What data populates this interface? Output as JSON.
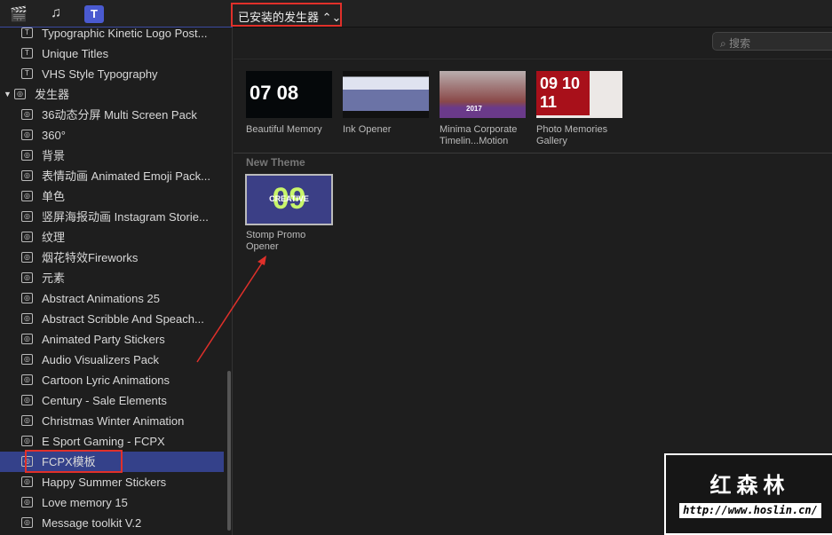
{
  "toolbar": {
    "icons": [
      "clapper-star-icon",
      "music-photo-icon",
      "titles-generators-icon"
    ],
    "selector_label": "已安装的发生器 ⌃⌄"
  },
  "sidebar": {
    "items": [
      {
        "label": "Typographic Kinetic Logo Post...",
        "icon": "title-icon"
      },
      {
        "label": "Unique Titles",
        "icon": "title-icon"
      },
      {
        "label": "VHS Style Typography",
        "icon": "title-icon"
      },
      {
        "label": "发生器",
        "icon": "generator-icon",
        "group": true
      },
      {
        "label": "36动态分屏 Multi Screen Pack",
        "icon": "generator-icon"
      },
      {
        "label": "360°",
        "icon": "generator-icon"
      },
      {
        "label": "背景",
        "icon": "generator-icon"
      },
      {
        "label": "表情动画 Animated Emoji Pack...",
        "icon": "generator-icon"
      },
      {
        "label": "单色",
        "icon": "generator-icon"
      },
      {
        "label": "竖屏海报动画 Instagram Storie...",
        "icon": "generator-icon"
      },
      {
        "label": "纹理",
        "icon": "generator-icon"
      },
      {
        "label": "烟花特效Fireworks",
        "icon": "generator-icon"
      },
      {
        "label": "元素",
        "icon": "generator-icon"
      },
      {
        "label": "Abstract Animations 25",
        "icon": "generator-icon"
      },
      {
        "label": "Abstract Scribble And Speach...",
        "icon": "generator-icon"
      },
      {
        "label": "Animated Party Stickers",
        "icon": "generator-icon"
      },
      {
        "label": "Audio Visualizers Pack",
        "icon": "generator-icon"
      },
      {
        "label": "Cartoon Lyric Animations",
        "icon": "generator-icon"
      },
      {
        "label": "Century - Sale Elements",
        "icon": "generator-icon"
      },
      {
        "label": "Christmas Winter Animation",
        "icon": "generator-icon"
      },
      {
        "label": "E Sport Gaming - FCPX",
        "icon": "generator-icon"
      },
      {
        "label": "FCPX模板",
        "icon": "generator-icon",
        "selected": true
      },
      {
        "label": "Happy Summer Stickers",
        "icon": "generator-icon"
      },
      {
        "label": "Love memory 15",
        "icon": "generator-icon"
      },
      {
        "label": "Message toolkit V.2",
        "icon": "generator-icon"
      }
    ]
  },
  "search": {
    "placeholder": "搜索"
  },
  "browser": {
    "items": [
      {
        "label": "Beautiful Memory",
        "thumb_text": "07 08"
      },
      {
        "label": "Ink Opener"
      },
      {
        "label": "Minima Corporate Timelin...Motion",
        "thumb_text": "2017"
      },
      {
        "label": "Photo Memories Gallery",
        "thumb_text": "09 10 11"
      }
    ],
    "section": "New Theme",
    "section_items": [
      {
        "label": "Stomp Promo Opener",
        "thumb_text": "09",
        "thumb_sub": "CREATIVE"
      }
    ]
  },
  "watermark": {
    "title": "红森林",
    "url": "http://www.hoslin.cn/"
  }
}
